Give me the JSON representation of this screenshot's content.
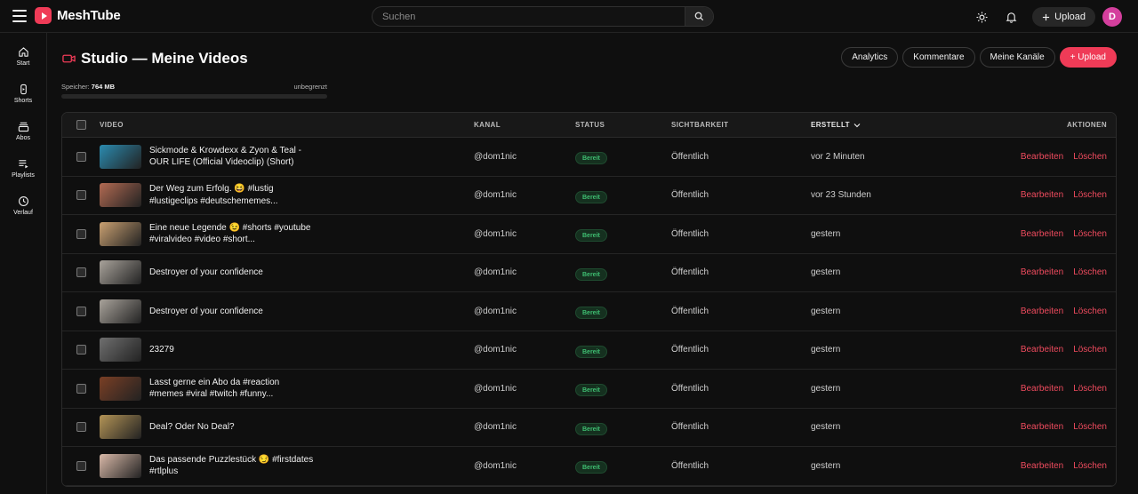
{
  "app": {
    "name": "MeshTube",
    "avatar_letter": "D",
    "accent": "#ef3b57"
  },
  "search": {
    "placeholder": "Suchen"
  },
  "topbar": {
    "upload_label": "Upload"
  },
  "sidebar": {
    "items": [
      {
        "label": "Start",
        "icon": "home-icon"
      },
      {
        "label": "Shorts",
        "icon": "shorts-icon"
      },
      {
        "label": "Abos",
        "icon": "subscriptions-icon"
      },
      {
        "label": "Playlists",
        "icon": "playlist-icon"
      },
      {
        "label": "Verlauf",
        "icon": "history-icon"
      }
    ]
  },
  "page": {
    "title": "Studio — Meine Videos",
    "actions": [
      "Analytics",
      "Kommentare",
      "Meine Kanäle",
      "+ Upload"
    ]
  },
  "storage": {
    "label": "Speicher:",
    "value": "764 MB",
    "limit": "unbegrenzt",
    "fill_percent": 0
  },
  "table": {
    "headers": {
      "video": "VIDEO",
      "channel": "KANAL",
      "status": "STATUS",
      "visibility": "SICHTBARKEIT",
      "created": "ERSTELLT",
      "actions": "AKTIONEN"
    },
    "action_edit": "Bearbeiten",
    "action_delete": "Löschen",
    "rows": [
      {
        "title": "Sickmode & Krowdexx & Zyon & Teal - OUR LIFE (Official Videoclip) (Short)",
        "channel": "@dom1nic",
        "status": "Bereit",
        "visibility": "Öffentlich",
        "created": "vor 2 Minuten",
        "thumb_color": "#2b8bb0"
      },
      {
        "title": "Der Weg zum Erfolg. 😆 #lustig #lustigeclips #deutschememes...",
        "channel": "@dom1nic",
        "status": "Bereit",
        "visibility": "Öffentlich",
        "created": "vor 23 Stunden",
        "thumb_color": "#b26a52"
      },
      {
        "title": "Eine neue Legende 😉 #shorts #youtube #viralvideo #video #short...",
        "channel": "@dom1nic",
        "status": "Bereit",
        "visibility": "Öffentlich",
        "created": "gestern",
        "thumb_color": "#c9a071"
      },
      {
        "title": "Destroyer of your confidence",
        "channel": "@dom1nic",
        "status": "Bereit",
        "visibility": "Öffentlich",
        "created": "gestern",
        "thumb_color": "#a9a39b"
      },
      {
        "title": "Destroyer of your confidence",
        "channel": "@dom1nic",
        "status": "Bereit",
        "visibility": "Öffentlich",
        "created": "gestern",
        "thumb_color": "#a9a39b"
      },
      {
        "title": "23279",
        "channel": "@dom1nic",
        "status": "Bereit",
        "visibility": "Öffentlich",
        "created": "gestern",
        "thumb_color": "#6f6f6f"
      },
      {
        "title": "Lasst gerne ein Abo da #reaction #memes #viral #twitch #funny...",
        "channel": "@dom1nic",
        "status": "Bereit",
        "visibility": "Öffentlich",
        "created": "gestern",
        "thumb_color": "#7a3f25"
      },
      {
        "title": "Deal? Oder No Deal?",
        "channel": "@dom1nic",
        "status": "Bereit",
        "visibility": "Öffentlich",
        "created": "gestern",
        "thumb_color": "#b49456"
      },
      {
        "title": "Das passende Puzzlestück 😏 #firstdates #rtlplus",
        "channel": "@dom1nic",
        "status": "Bereit",
        "visibility": "Öffentlich",
        "created": "gestern",
        "thumb_color": "#d9b9a8"
      }
    ]
  }
}
